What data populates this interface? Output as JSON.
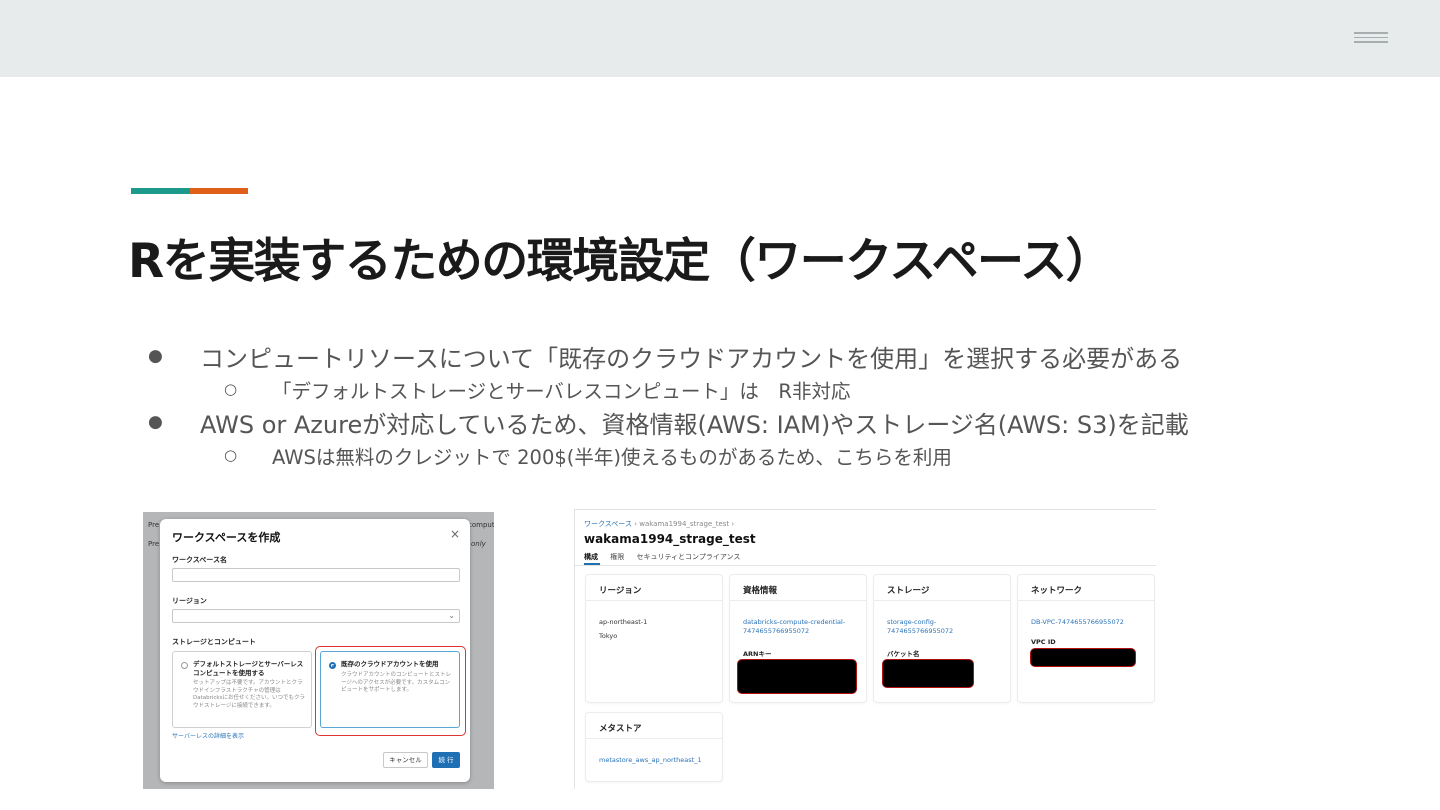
{
  "title": "Rを実装するための環境設定（ワークスペース）",
  "bullets": [
    {
      "text": "コンピュートリソースについて「既存のクラウドアカウントを使用」を選択する必要がある"
    },
    {
      "text": "「デフォルトストレージとサーバレスコンピュート」は　R非対応"
    },
    {
      "text": "AWS or Azureが対応しているため、資格情報(AWS: IAM)やストレージ名(AWS: S3)を記載"
    },
    {
      "text": "AWSは無料のクレジットで 200$(半年)使えるものがあるため、こちらを利用"
    }
  ],
  "markers": {
    "bullet": "●",
    "sub": "○"
  },
  "left_screenshot": {
    "bg_left_top": "Pre",
    "bg_left_mid": "Pre",
    "bg_right_top": "compute",
    "bg_right_mid": "only",
    "dialog_title": "ワークスペースを作成",
    "close_glyph": "×",
    "name_label": "ワークスペース名",
    "region_label": "リージョン",
    "region_chevron": "⌄",
    "section_label": "ストレージとコンピュート",
    "option_default_title": "デフォルトストレージとサーバーレスコンピュートを使用する",
    "option_default_desc": "セットアップは不要です。アカウントとクラウドインフラストラクチャの管理はDatabricksにお任せください。いつでもクラウドストレージに接続できます。",
    "option_existing_title": "既存のクラウドアカウントを使用",
    "option_existing_desc": "クラウドアカウントのコンピュートとストレージへのアクセスが必要です。カスタムコンピュートをサポートします。",
    "details_link": "サーバーレスの詳細を表示",
    "cancel_button": "キャンセル",
    "continue_button": "続 行"
  },
  "right_screenshot": {
    "breadcrumb_root": "ワークスペース",
    "breadcrumb_sep": "›",
    "breadcrumb_current": "wakama1994_strage_test",
    "workspace_title": "wakama1994_strage_test",
    "tabs": [
      "構成",
      "権限",
      "セキュリティとコンプライアンス"
    ],
    "cards": {
      "region": {
        "header": "リージョン",
        "code": "ap-northeast-1",
        "city": "Tokyo"
      },
      "credentials": {
        "header": "資格情報",
        "link": "databricks-compute-credential-7474655766955072",
        "label": "ARNキー"
      },
      "storage": {
        "header": "ストレージ",
        "link": "storage-config-7474655766955072",
        "label": "バケット名"
      },
      "network": {
        "header": "ネットワーク",
        "link": "DB-VPC-7474655766955072",
        "label": "VPC ID"
      },
      "metastore": {
        "header": "メタストア",
        "link": "metastore_aws_ap_northeast_1"
      }
    }
  },
  "colors": {
    "accent_teal": "#1e9a8c",
    "accent_orange": "#e0601a",
    "link_blue": "#2a73b8",
    "primary_button": "#1f6fb5",
    "highlight_red": "#d33333"
  },
  "icons": {
    "menu": "hamburger-menu-icon"
  }
}
